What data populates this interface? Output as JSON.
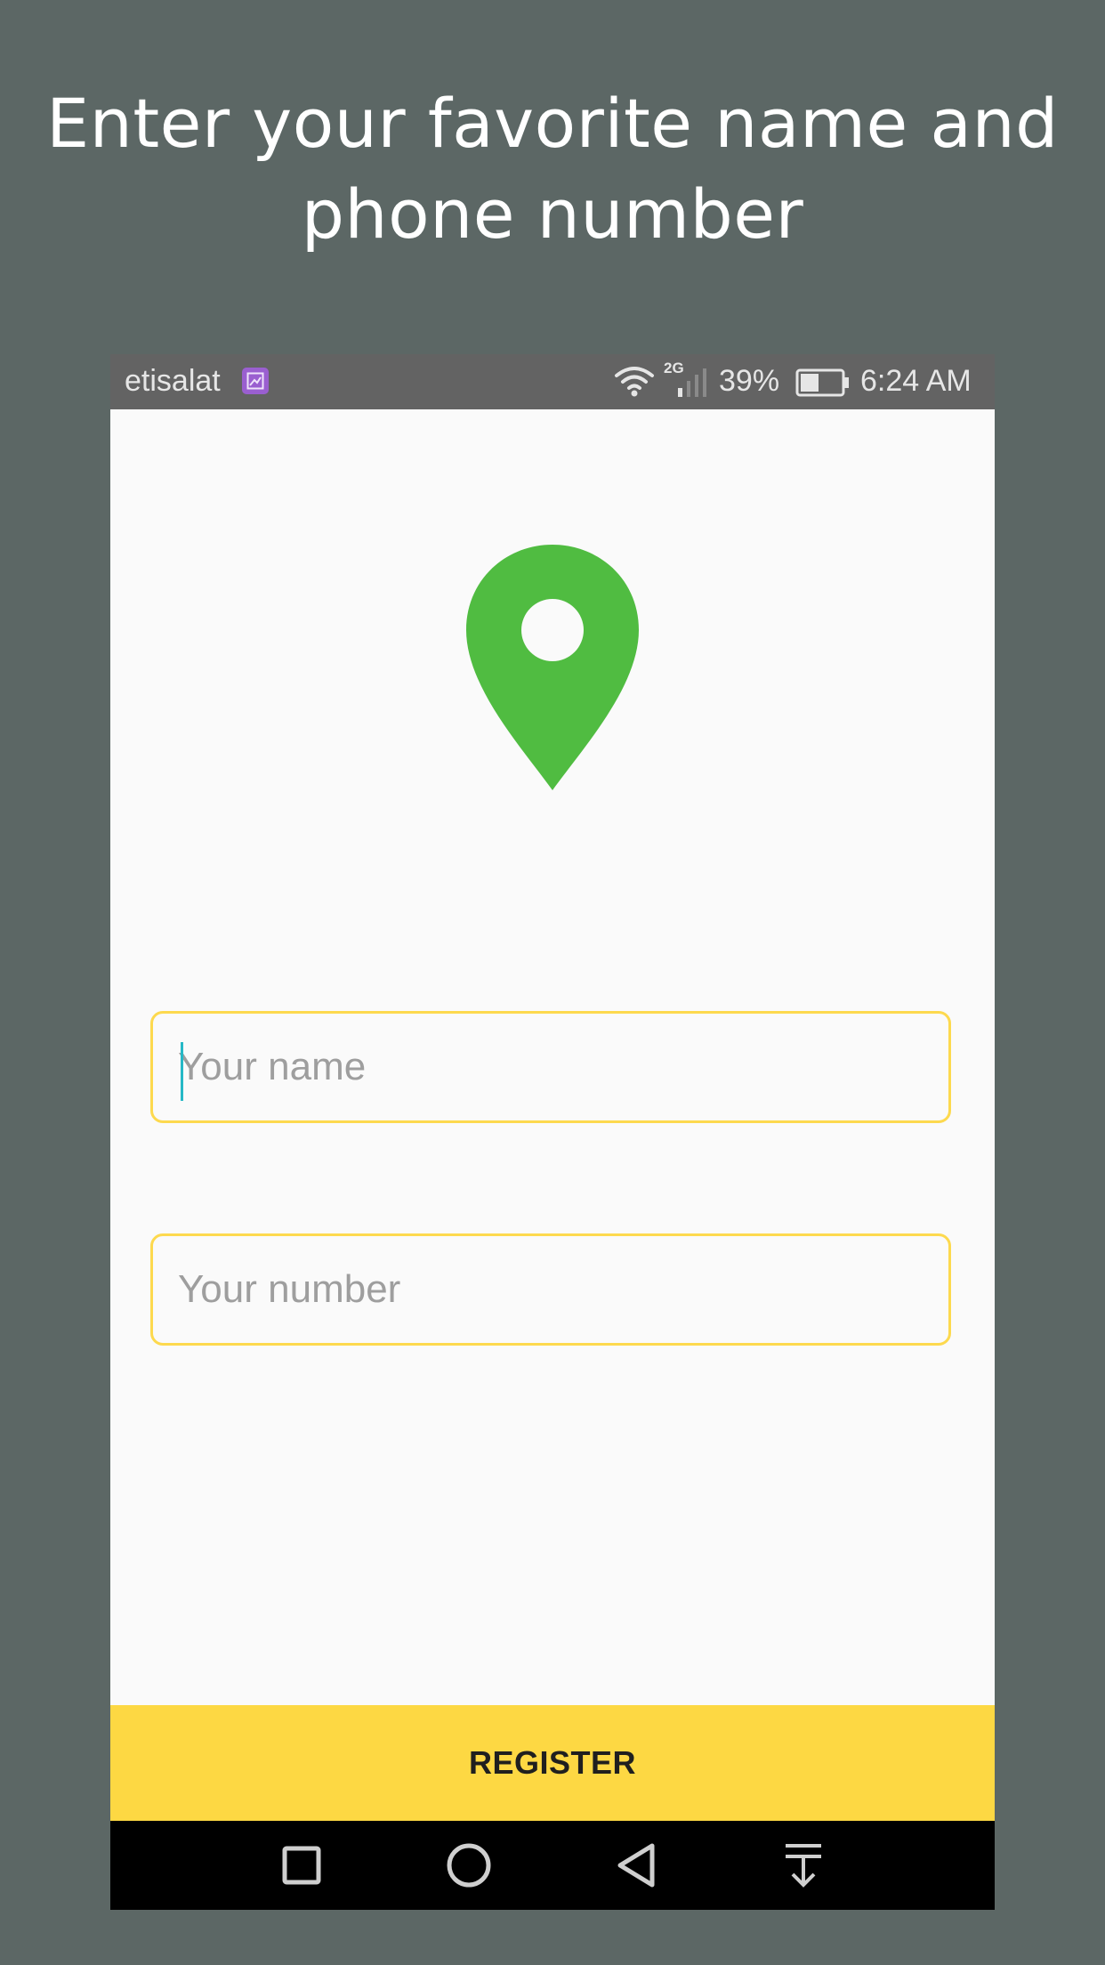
{
  "headline": {
    "line1": "Enter your favorite name and",
    "line2": "phone number"
  },
  "status_bar": {
    "carrier": "etisalat",
    "network_type": "2G",
    "battery": "39%",
    "time": "6:24 AM"
  },
  "icons": {
    "app_logo": "location-pin-icon",
    "logo_color": "#50bc41"
  },
  "form": {
    "name_placeholder": "Your name",
    "number_placeholder": "Your number",
    "field_border_color": "#fdd94e"
  },
  "register_button": {
    "label": "REGISTER",
    "color": "#fdd843"
  },
  "nav_bar": {
    "buttons": [
      "recent-apps-icon",
      "home-icon",
      "back-icon",
      "notification-pull-icon"
    ]
  }
}
